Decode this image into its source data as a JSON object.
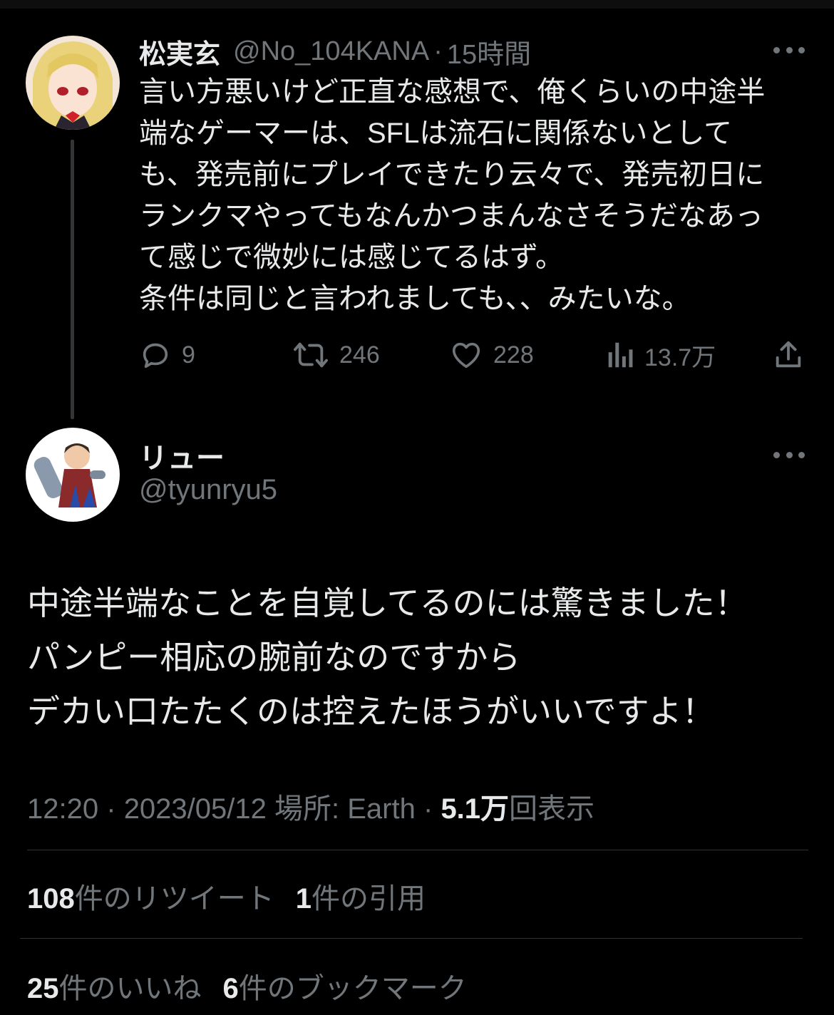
{
  "parent_tweet": {
    "display_name": "松実玄",
    "handle": "@No_104KANA",
    "separator": "·",
    "time_ago": "15時間",
    "text_lines": [
      "言い方悪いけど正直な感想で、俺くらいの中途半",
      "端なゲーマーは、SFLは流石に関係ないとして",
      "も、発売前にプレイできたり云々で、発売初日に",
      "ランクマやってもなんかつまんなさそうだなあっ",
      "て感じで微妙には感じてるはず。",
      "条件は同じと言われましても、、みたいな。"
    ],
    "reply_count": "9",
    "retweet_count": "246",
    "like_count": "228",
    "view_count": "13.7万",
    "icons": [
      "reply-icon",
      "retweet-icon",
      "like-icon",
      "views-icon",
      "share-icon",
      "more-icon"
    ]
  },
  "reply_tweet": {
    "display_name": "リュー",
    "handle": "@tyunryu5",
    "text_lines": [
      "中途半端なことを自覚してるのには驚きました！",
      "パンピー相応の腕前なのですから",
      "デカい口たたくのは控えたほうがいいですよ！"
    ],
    "time": "12:20",
    "date": "2023/05/12",
    "location_label": "場所: Earth",
    "views_value": "5.1万",
    "views_label": "回表示",
    "separator": "·"
  },
  "engagement": {
    "retweets_num": "108",
    "retweets_label": "件のリツイート",
    "quotes_num": "1",
    "quotes_label": "件の引用",
    "likes_num": "25",
    "likes_label": "件のいいね",
    "bookmarks_num": "6",
    "bookmarks_label": "件のブックマーク"
  },
  "colors": {
    "background": "#000000",
    "primary_text": "#e7e9ea",
    "secondary_text": "#71767b",
    "divider": "#2f3336"
  }
}
